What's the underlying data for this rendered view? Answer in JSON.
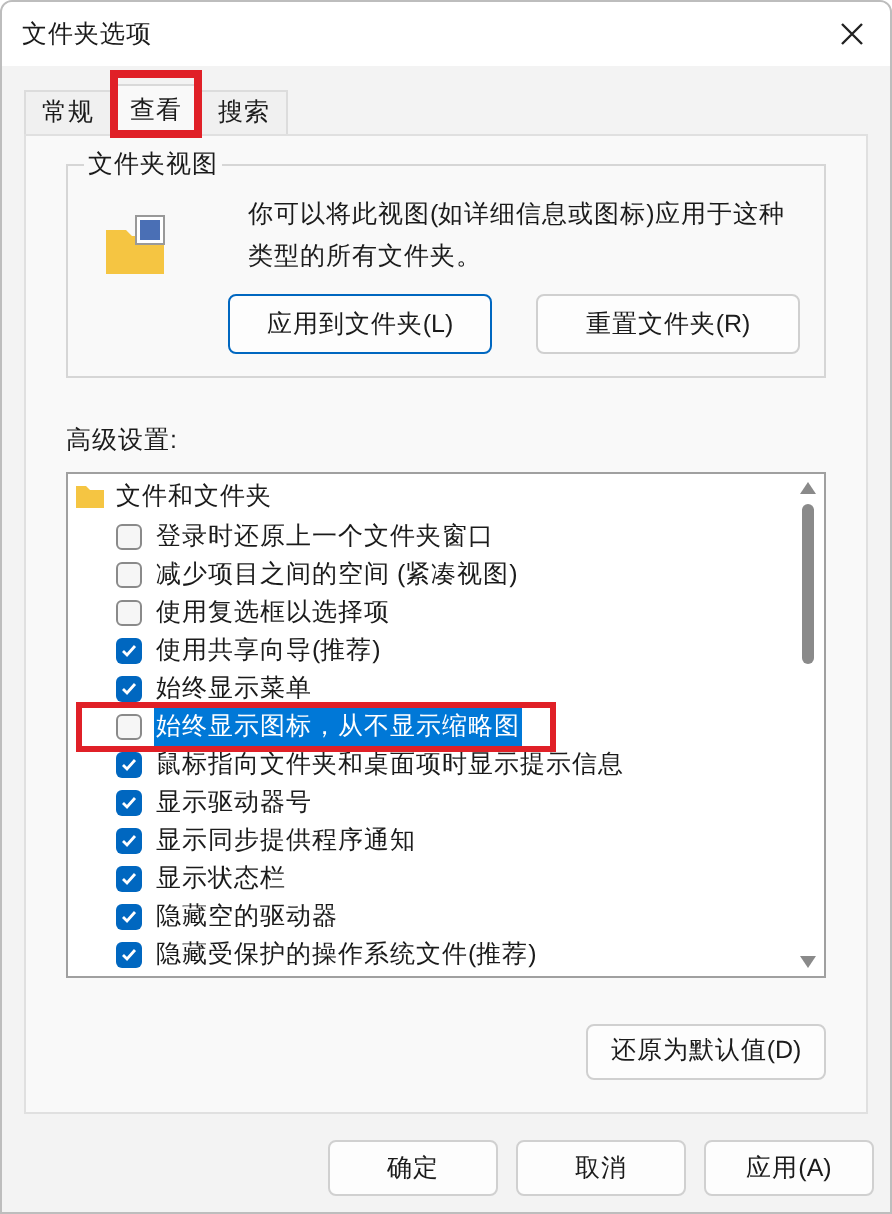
{
  "window": {
    "title": "文件夹选项"
  },
  "tabs": [
    {
      "label": "常规",
      "selected": false
    },
    {
      "label": "查看",
      "selected": true,
      "highlighted": true
    },
    {
      "label": "搜索",
      "selected": false
    }
  ],
  "folder_views": {
    "title": "文件夹视图",
    "description": "你可以将此视图(如详细信息或图标)应用于这种类型的所有文件夹。",
    "buttons": [
      {
        "label": "应用到文件夹(L)",
        "focused": true
      },
      {
        "label": "重置文件夹(R)",
        "focused": false
      }
    ]
  },
  "advanced": {
    "label": "高级设置:",
    "group": "文件和文件夹",
    "items": [
      {
        "label": "登录时还原上一个文件夹窗口",
        "checked": false,
        "selected": false,
        "highlighted": false
      },
      {
        "label": "减少项目之间的空间 (紧凑视图)",
        "checked": false,
        "selected": false,
        "highlighted": false
      },
      {
        "label": "使用复选框以选择项",
        "checked": false,
        "selected": false,
        "highlighted": false
      },
      {
        "label": "使用共享向导(推荐)",
        "checked": true,
        "selected": false,
        "highlighted": false
      },
      {
        "label": "始终显示菜单",
        "checked": true,
        "selected": false,
        "highlighted": false
      },
      {
        "label": "始终显示图标，从不显示缩略图",
        "checked": false,
        "selected": true,
        "highlighted": true
      },
      {
        "label": "鼠标指向文件夹和桌面项时显示提示信息",
        "checked": true,
        "selected": false,
        "highlighted": false
      },
      {
        "label": "显示驱动器号",
        "checked": true,
        "selected": false,
        "highlighted": false
      },
      {
        "label": "显示同步提供程序通知",
        "checked": true,
        "selected": false,
        "highlighted": false
      },
      {
        "label": "显示状态栏",
        "checked": true,
        "selected": false,
        "highlighted": false
      },
      {
        "label": "隐藏空的驱动器",
        "checked": true,
        "selected": false,
        "highlighted": false
      },
      {
        "label": "隐藏受保护的操作系统文件(推荐)",
        "checked": true,
        "selected": false,
        "highlighted": false
      }
    ],
    "restore_button": "还原为默认值(D)"
  },
  "buttons": [
    "确定",
    "取消",
    "应用(A)"
  ]
}
